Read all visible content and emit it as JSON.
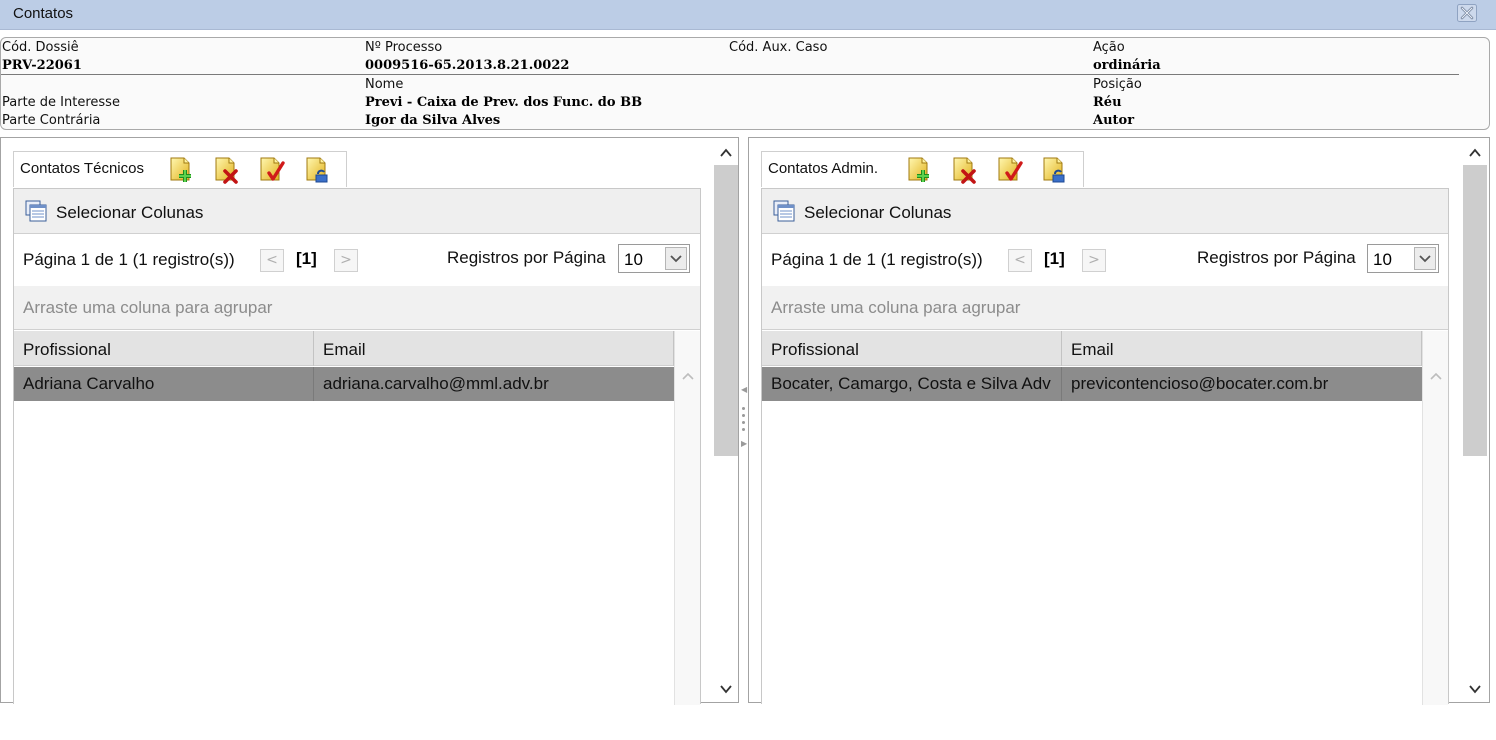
{
  "window": {
    "title": "Contatos",
    "close_icon": "close-icon"
  },
  "info": {
    "cod_dossie_label": "Cód. Dossiê",
    "cod_dossie_value": "PRV-22061",
    "processo_label": "Nº Processo",
    "processo_value": "0009516-65.2013.8.21.0022",
    "cod_aux_label": "Cód. Aux. Caso",
    "acao_label": "Ação",
    "acao_value": "ordinária",
    "nome_label": "Nome",
    "posicao_label": "Posição",
    "parte_interesse_label": "Parte de Interesse",
    "parte_interesse_nome": "Previ - Caixa de Prev. dos Func. do BB",
    "parte_interesse_posicao": "Réu",
    "parte_contraria_label": "Parte Contrária",
    "parte_contraria_nome": "Igor da Silva Alves",
    "parte_contraria_posicao": "Autor"
  },
  "panels": [
    {
      "title": "Contatos Técnicos",
      "select_columns": "Selecionar Colunas",
      "page_info": "Página 1 de 1 (1 registro(s))",
      "current_page": "[1]",
      "prev_symbol": "<",
      "next_symbol": ">",
      "per_page_label": "Registros por Página",
      "per_page_value": "10",
      "group_hint": "Arraste uma coluna para agrupar",
      "columns": [
        "Profissional",
        "Email"
      ],
      "rows": [
        [
          "Adriana Carvalho",
          "adriana.carvalho@mml.adv.br"
        ]
      ]
    },
    {
      "title": "Contatos Admin.",
      "select_columns": "Selecionar Colunas",
      "page_info": "Página 1 de 1 (1 registro(s))",
      "current_page": "[1]",
      "prev_symbol": "<",
      "next_symbol": ">",
      "per_page_label": "Registros por Página",
      "per_page_value": "10",
      "group_hint": "Arraste uma coluna para agrupar",
      "columns": [
        "Profissional",
        "Email"
      ],
      "rows": [
        [
          "Bocater, Camargo, Costa e Silva Adv",
          "previcontencioso@bocater.com.br"
        ]
      ]
    }
  ],
  "toolbar_icons": [
    "add-contact-icon",
    "delete-contact-icon",
    "edit-contact-icon",
    "export-contact-icon"
  ],
  "colors": {
    "titlebar": "#bccde6",
    "selected_row": "#8c8c8c",
    "header": "#e3e3e3"
  }
}
